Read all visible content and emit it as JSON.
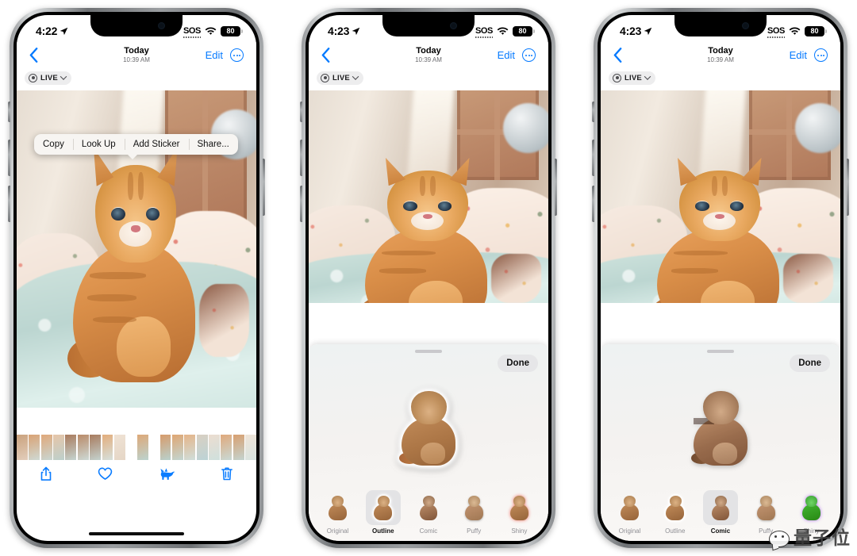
{
  "app": {
    "name": "iOS Photos"
  },
  "phones": [
    {
      "id": "phone-1",
      "status": {
        "time": "4:22",
        "location_icon": "location-arrow-icon",
        "sos": "SOS",
        "wifi_icon": "wifi-icon",
        "battery": "80"
      },
      "nav": {
        "back_icon": "chevron-left-icon",
        "title": "Today",
        "subtitle": "10:39 AM",
        "edit": "Edit",
        "more_icon": "ellipsis-circle-icon"
      },
      "live_badge": {
        "icon": "live-photo-icon",
        "label": "LIVE",
        "chevron": "chevron-down-icon"
      },
      "context_menu": {
        "items": [
          "Copy",
          "Look Up",
          "Add Sticker",
          "Share..."
        ]
      },
      "toolbar": {
        "items": [
          "share-icon",
          "heart-icon",
          "cat-icon",
          "trash-icon"
        ]
      },
      "mode": "viewer"
    },
    {
      "id": "phone-2",
      "status": {
        "time": "4:23",
        "location_icon": "location-arrow-icon",
        "sos": "SOS",
        "wifi_icon": "wifi-icon",
        "battery": "80"
      },
      "nav": {
        "back_icon": "chevron-left-icon",
        "title": "Today",
        "subtitle": "10:39 AM",
        "edit": "Edit",
        "more_icon": "ellipsis-circle-icon"
      },
      "live_badge": {
        "icon": "live-photo-icon",
        "label": "LIVE",
        "chevron": "chevron-down-icon"
      },
      "sheet": {
        "done_label": "Done",
        "selected_style": "Outline",
        "styles": [
          "Original",
          "Outline",
          "Comic",
          "Puffy",
          "Shiny"
        ]
      },
      "mode": "sticker-editor"
    },
    {
      "id": "phone-3",
      "status": {
        "time": "4:23",
        "location_icon": "location-arrow-icon",
        "sos": "SOS",
        "wifi_icon": "wifi-icon",
        "battery": "80"
      },
      "nav": {
        "back_icon": "chevron-left-icon",
        "title": "Today",
        "subtitle": "10:39 AM",
        "edit": "Edit",
        "more_icon": "ellipsis-circle-icon"
      },
      "live_badge": {
        "icon": "live-photo-icon",
        "label": "LIVE",
        "chevron": "chevron-down-icon"
      },
      "sheet": {
        "done_label": "Done",
        "selected_style": "Comic",
        "styles": [
          "Original",
          "Outline",
          "Comic",
          "Puffy",
          "Shiny"
        ]
      },
      "mode": "sticker-editor"
    }
  ],
  "watermark": {
    "text": "量子位",
    "logo_icon": "qbitai-logo-icon"
  },
  "colors": {
    "accent_blue": "#067aff",
    "sheet_bg": "#f2f1ef",
    "label_grey": "#8e8e93"
  }
}
